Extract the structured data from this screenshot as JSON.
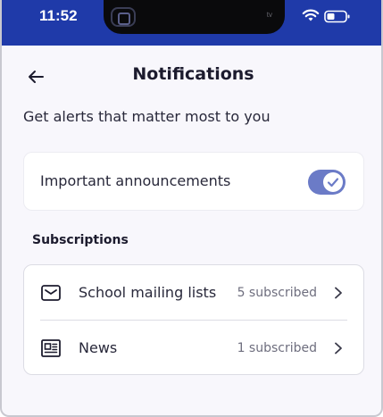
{
  "status_bar": {
    "time": "11:52",
    "island_text": "tv",
    "icons": [
      "screen-record-icon",
      "wifi-icon",
      "battery-icon"
    ],
    "background_color": "#1f3aa9"
  },
  "header": {
    "back_icon": "arrow-left-icon",
    "title": "Notifications"
  },
  "subtitle": "Get alerts that matter most to you",
  "announcements": {
    "label": "Important announcements",
    "enabled": true,
    "toggle_color": "#6b7bc7"
  },
  "subscriptions": {
    "section_title": "Subscriptions",
    "items": [
      {
        "icon": "envelope-icon",
        "label": "School mailing lists",
        "count": "5 subscribed"
      },
      {
        "icon": "newspaper-icon",
        "label": "News",
        "count": "1 subscribed"
      }
    ]
  }
}
